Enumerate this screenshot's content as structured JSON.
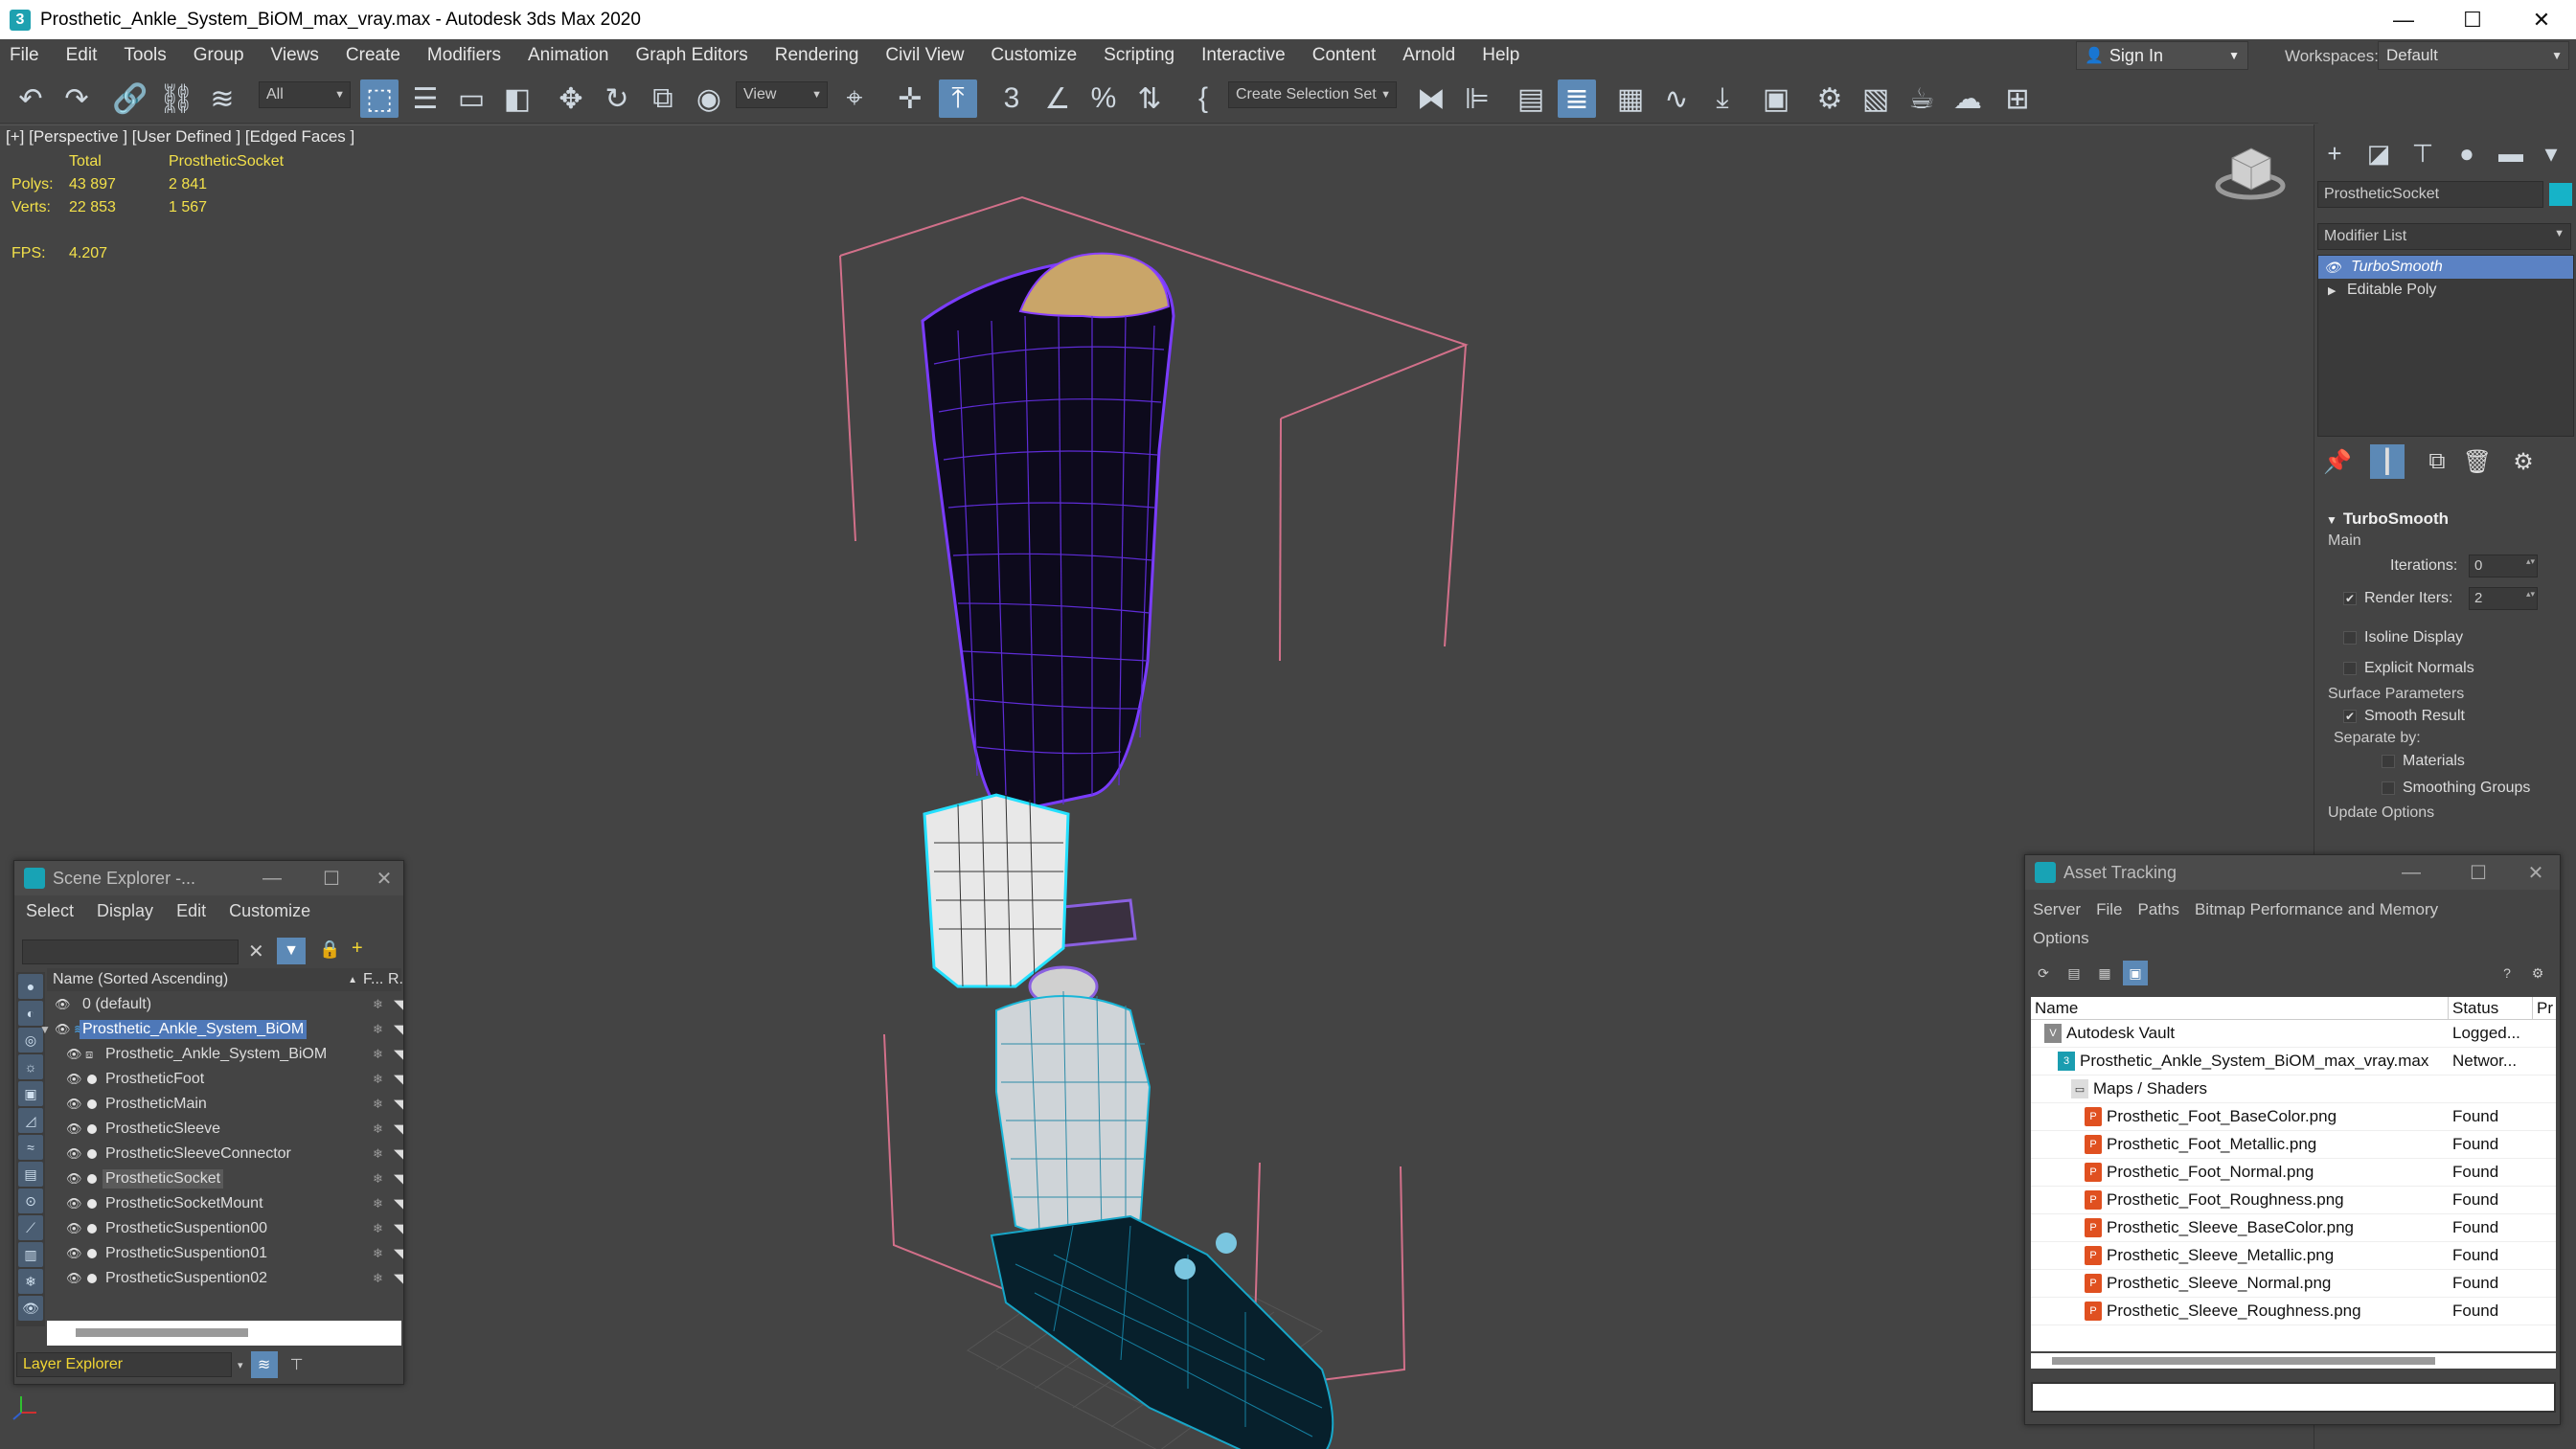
{
  "window": {
    "title": "Prosthetic_Ankle_System_BiOM_max_vray.max - Autodesk 3ds Max 2020",
    "min_label": "—",
    "max_label": "☐",
    "close_label": "✕"
  },
  "menubar": {
    "items": [
      "File",
      "Edit",
      "Tools",
      "Group",
      "Views",
      "Create",
      "Modifiers",
      "Animation",
      "Graph Editors",
      "Rendering",
      "Civil View",
      "Customize",
      "Scripting",
      "Interactive",
      "Content",
      "Arnold",
      "Help"
    ],
    "signin": "Sign In",
    "workspaces_label": "Workspaces:",
    "workspace": "Default"
  },
  "toolbar": {
    "filter": "All",
    "ref_coord": "View",
    "selection_set": "Create Selection Set"
  },
  "viewport": {
    "label": "[+] [Perspective ] [User Defined ] [Edged Faces ]",
    "stats": {
      "col_total": "Total",
      "col_object": "ProstheticSocket",
      "polys_label": "Polys:",
      "polys_total": "43 897",
      "polys_object": "2 841",
      "verts_label": "Verts:",
      "verts_total": "22 853",
      "verts_object": "1 567",
      "fps_label": "FPS:",
      "fps_value": "4.207"
    }
  },
  "command_panel": {
    "object_name": "ProstheticSocket",
    "object_color": "#16b3c8",
    "modifier_list": "Modifier List",
    "stack": [
      "TurboSmooth",
      "Editable Poly"
    ],
    "rollout": {
      "title": "TurboSmooth",
      "main": "Main",
      "iterations_label": "Iterations:",
      "iterations_value": "0",
      "render_iters_label": "Render Iters:",
      "render_iters_value": "2",
      "render_iters_checked": true,
      "isoline": "Isoline Display",
      "explicit_normals": "Explicit Normals",
      "surface_params": "Surface Parameters",
      "smooth_result": "Smooth Result",
      "separate_by": "Separate by:",
      "materials": "Materials",
      "smoothing_groups": "Smoothing Groups",
      "update_options": "Update Options"
    }
  },
  "scene_explorer": {
    "title": "Scene Explorer -...",
    "menu": [
      "Select",
      "Display",
      "Edit",
      "Customize"
    ],
    "col_name": "Name (Sorted Ascending)",
    "col_frozen": "F...",
    "col_render": "R.",
    "rows": [
      {
        "label": "0 (default)",
        "indent": 0,
        "toggle": "",
        "layer": true,
        "selected": false
      },
      {
        "label": "Prosthetic_Ankle_System_BiOM",
        "indent": 0,
        "toggle": "◢",
        "layer": true,
        "selected": false,
        "blue": true
      },
      {
        "label": "Prosthetic_Ankle_System_BiOM",
        "indent": 1,
        "toggle": "",
        "layer": false,
        "group": true,
        "selected": false
      },
      {
        "label": "ProstheticFoot",
        "indent": 1,
        "toggle": "",
        "selected": false
      },
      {
        "label": "ProstheticMain",
        "indent": 1,
        "toggle": "",
        "selected": false
      },
      {
        "label": "ProstheticSleeve",
        "indent": 1,
        "toggle": "",
        "selected": false
      },
      {
        "label": "ProstheticSleeveConnector",
        "indent": 1,
        "toggle": "",
        "selected": false
      },
      {
        "label": "ProstheticSocket",
        "indent": 1,
        "toggle": "",
        "selected": true
      },
      {
        "label": "ProstheticSocketMount",
        "indent": 1,
        "toggle": "",
        "selected": false
      },
      {
        "label": "ProstheticSuspention00",
        "indent": 1,
        "toggle": "",
        "selected": false
      },
      {
        "label": "ProstheticSuspention01",
        "indent": 1,
        "toggle": "",
        "selected": false
      },
      {
        "label": "ProstheticSuspention02",
        "indent": 1,
        "toggle": "",
        "selected": false
      }
    ],
    "footer": "Layer Explorer"
  },
  "asset_tracking": {
    "title": "Asset Tracking",
    "menu": [
      "Server",
      "File",
      "Paths",
      "Bitmap Performance and Memory",
      "Options"
    ],
    "col_name": "Name",
    "col_status": "Status",
    "col_extra": "Pr",
    "rows": [
      {
        "name": "Autodesk Vault",
        "status": "Logged...",
        "indent": 1,
        "icon": "vault"
      },
      {
        "name": "Prosthetic_Ankle_System_BiOM_max_vray.max",
        "status": "Networ...",
        "indent": 2,
        "icon": "max"
      },
      {
        "name": "Maps / Shaders",
        "status": "",
        "indent": 3,
        "icon": "folder"
      },
      {
        "name": "Prosthetic_Foot_BaseColor.png",
        "status": "Found",
        "indent": 4,
        "icon": "png"
      },
      {
        "name": "Prosthetic_Foot_Metallic.png",
        "status": "Found",
        "indent": 4,
        "icon": "png"
      },
      {
        "name": "Prosthetic_Foot_Normal.png",
        "status": "Found",
        "indent": 4,
        "icon": "png"
      },
      {
        "name": "Prosthetic_Foot_Roughness.png",
        "status": "Found",
        "indent": 4,
        "icon": "png"
      },
      {
        "name": "Prosthetic_Sleeve_BaseColor.png",
        "status": "Found",
        "indent": 4,
        "icon": "png"
      },
      {
        "name": "Prosthetic_Sleeve_Metallic.png",
        "status": "Found",
        "indent": 4,
        "icon": "png"
      },
      {
        "name": "Prosthetic_Sleeve_Normal.png",
        "status": "Found",
        "indent": 4,
        "icon": "png"
      },
      {
        "name": "Prosthetic_Sleeve_Roughness.png",
        "status": "Found",
        "indent": 4,
        "icon": "png"
      }
    ]
  }
}
